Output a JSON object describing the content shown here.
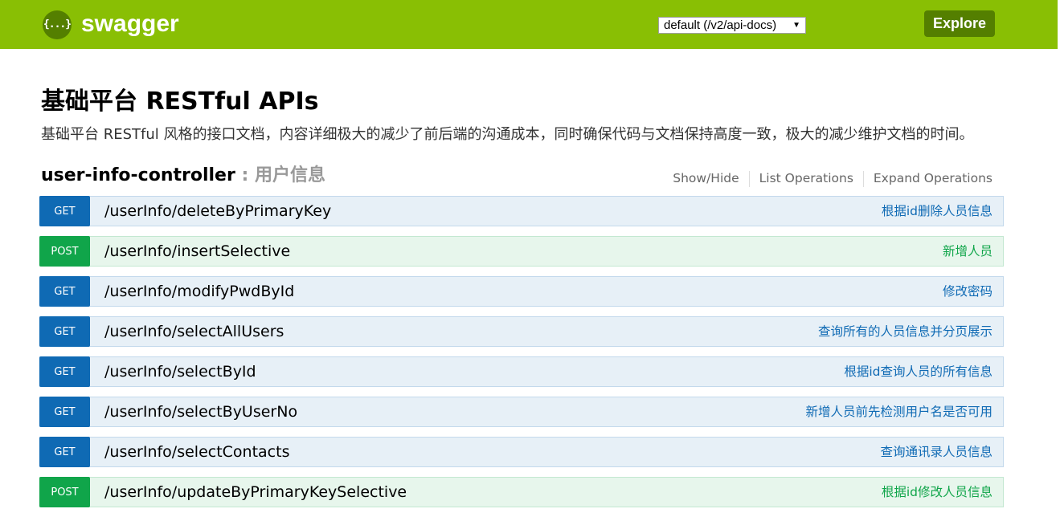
{
  "header": {
    "logo_icon_text": "{...}",
    "brand": "swagger",
    "api_selector": "default (/v2/api-docs)",
    "explore_label": "Explore"
  },
  "page": {
    "title": "基础平台 RESTful APIs",
    "description": "基础平台 RESTful 风格的接口文档，内容详细极大的减少了前后端的沟通成本，同时确保代码与文档保持高度一致，极大的减少维护文档的时间。"
  },
  "controller": {
    "name": "user-info-controller",
    "separator": " : ",
    "description": "用户信息",
    "show_hide": "Show/Hide",
    "list_operations": "List Operations",
    "expand_operations": "Expand Operations"
  },
  "endpoints": [
    {
      "method": "GET",
      "path": "/userInfo/deleteByPrimaryKey",
      "summary": "根据id删除人员信息"
    },
    {
      "method": "POST",
      "path": "/userInfo/insertSelective",
      "summary": "新增人员"
    },
    {
      "method": "GET",
      "path": "/userInfo/modifyPwdById",
      "summary": "修改密码"
    },
    {
      "method": "GET",
      "path": "/userInfo/selectAllUsers",
      "summary": "查询所有的人员信息并分页展示"
    },
    {
      "method": "GET",
      "path": "/userInfo/selectById",
      "summary": "根据id查询人员的所有信息"
    },
    {
      "method": "GET",
      "path": "/userInfo/selectByUserNo",
      "summary": "新增人员前先检测用户名是否可用"
    },
    {
      "method": "GET",
      "path": "/userInfo/selectContacts",
      "summary": "查询通讯录人员信息"
    },
    {
      "method": "POST",
      "path": "/userInfo/updateByPrimaryKeySelective",
      "summary": "根据id修改人员信息"
    }
  ],
  "colors": {
    "header_bg": "#89bf04",
    "explore_bg": "#547f00",
    "get": "#0f6ab4",
    "post": "#10a54a"
  }
}
